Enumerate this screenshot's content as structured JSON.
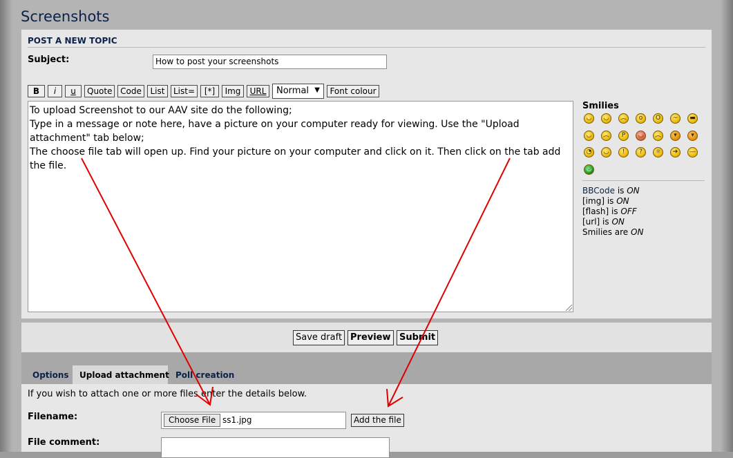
{
  "page": {
    "title": "Screenshots"
  },
  "post": {
    "section_title": "POST A NEW TOPIC",
    "subject_label": "Subject:",
    "subject_value": "How to post your screenshots",
    "toolbar": {
      "bold": "B",
      "italic": "i",
      "underline": "u",
      "quote": "Quote",
      "code": "Code",
      "list": "List",
      "list_eq": "List=",
      "list_item": "[*]",
      "img": "Img",
      "url": "URL",
      "size_selected": "Normal",
      "font_colour": "Font colour"
    },
    "message_lines": [
      "To upload  Screenshot to our AAV site do the following;",
      "Type in a message or note here, have a picture on your computer ready for viewing.  Use the \"Upload attachment\" tab below;",
      "The choose file tab will open up. Find your picture on your computer and click on it. Then click on the tab add the file."
    ]
  },
  "smilies": {
    "title": "Smilies",
    "icons": [
      "biggrin",
      "smile",
      "sad",
      "surprised",
      "eek",
      "confused",
      "cool",
      "lol",
      "mad",
      "razz",
      "redface",
      "cry",
      "evil",
      "twisted",
      "rolleyes",
      "wink",
      "exclaim",
      "question",
      "idea",
      "arrow",
      "neutral",
      "mrgreen"
    ]
  },
  "status": {
    "bbcode_label": "BBCode",
    "bbcode_is": "is",
    "bbcode_value": "ON",
    "img_label": "[img] is",
    "img_value": "ON",
    "flash_label": "[flash] is",
    "flash_value": "OFF",
    "url_label": "[url] is",
    "url_value": "ON",
    "smilies_label": "Smilies are",
    "smilies_value": "ON"
  },
  "actions": {
    "save_draft": "Save draft",
    "preview": "Preview",
    "submit": "Submit"
  },
  "tabs": [
    {
      "label": "Options"
    },
    {
      "label": "Upload attachment"
    },
    {
      "label": "Poll creation"
    }
  ],
  "attachment": {
    "info": "If you wish to attach one or more files enter the details below.",
    "filename_label": "Filename:",
    "choose_file": "Choose File",
    "file_name": "ss1.jpg",
    "add_file": "Add the file",
    "comment_label": "File comment:"
  },
  "annotation": {
    "arrow_color": "#e00000"
  }
}
